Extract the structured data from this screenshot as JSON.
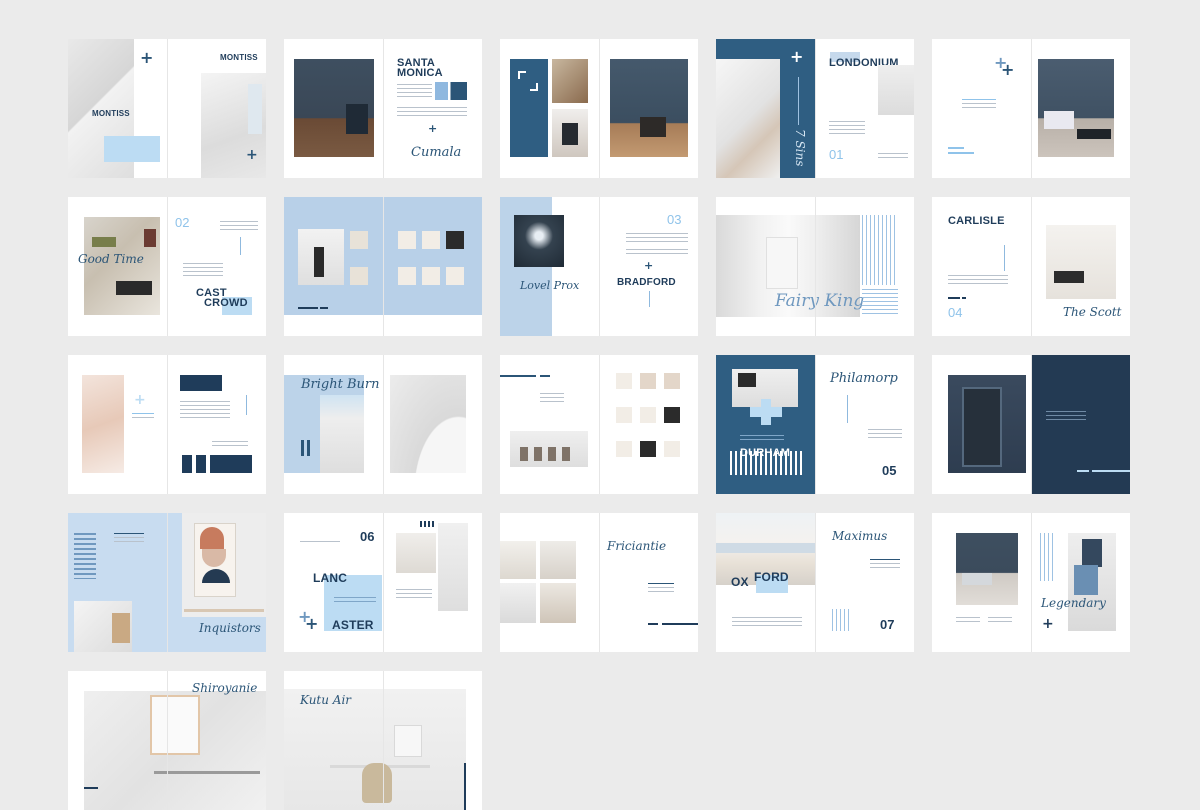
{
  "colors": {
    "navy": "#1f3c5a",
    "teal_blue": "#2f5e82",
    "light_blue": "#c6d9ec",
    "sky": "#bcdcf3",
    "accent": "#8fc3ea",
    "background": "#ebebeb"
  },
  "spreads": {
    "montiss": {
      "title_left": "MONTISS",
      "title_right": "MONTISS",
      "icon": "plus-icon"
    },
    "santa_monica": {
      "title_line1": "SANTA",
      "title_line2": "MONICA",
      "script": "Cumala"
    },
    "londonium": {
      "title": "LONDONIUM",
      "script": "7 Sins",
      "number": "01"
    },
    "castcrowd": {
      "script": "Good Time",
      "number": "02",
      "title_line1": "CAST",
      "title_line2": "CROWD"
    },
    "bradford": {
      "script": "Lovel Prox",
      "number": "03",
      "title": "BRADFORD"
    },
    "fairy_king": {
      "script": "Fairy King"
    },
    "carlisle": {
      "title": "CARLISLE",
      "number": "04",
      "script": "The Scott"
    },
    "bright_burn": {
      "script": "Bright Burn"
    },
    "durham": {
      "script": "Philamorp",
      "title": "DURHAM",
      "number": "05"
    },
    "inquistors": {
      "script": "Inquistors"
    },
    "lancaster": {
      "number": "06",
      "title_line1": "LANC",
      "title_line2": "ASTER"
    },
    "friciantie": {
      "script": "Friciantie"
    },
    "oxford": {
      "script": "Maximus",
      "title_part1": "OX",
      "title_part2": "FORD",
      "number": "07"
    },
    "legendary": {
      "script": "Legendary"
    },
    "shiroyanie": {
      "script": "Shiroyanie"
    },
    "kutu_air": {
      "script": "Kutu Air"
    }
  }
}
